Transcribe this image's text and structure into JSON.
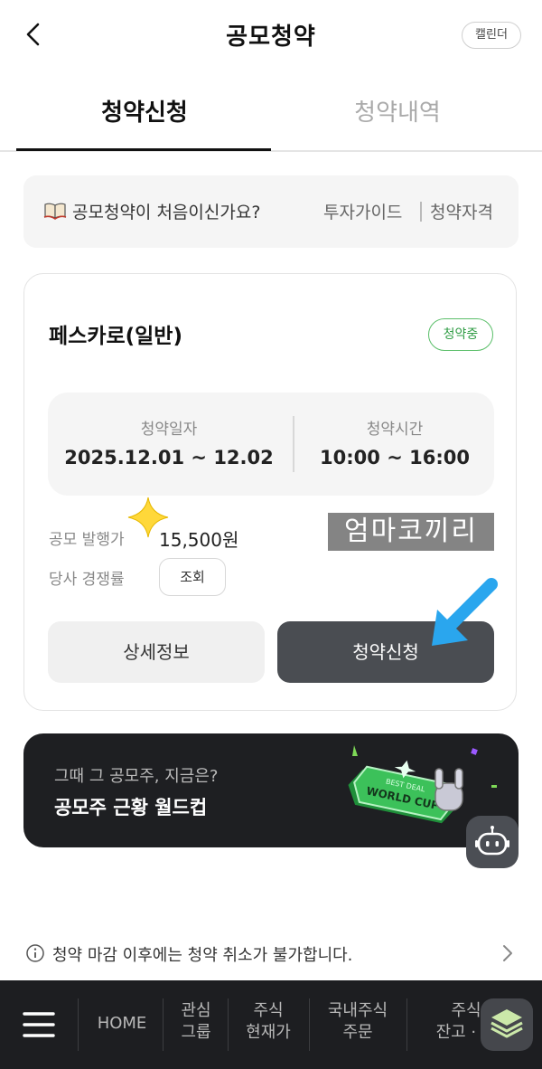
{
  "header": {
    "title": "공모청약",
    "calendar_label": "캘린더"
  },
  "tabs": [
    {
      "label": "청약신청",
      "active": true
    },
    {
      "label": "청약내역",
      "active": false
    }
  ],
  "guide": {
    "question": "공모청약이 처음이신가요?",
    "links": [
      "투자가이드",
      "청약자격"
    ]
  },
  "offering": {
    "name": "페스카로(일반)",
    "status": "청약중",
    "schedule": {
      "date_label": "청약일자",
      "date_value": "2025.12.01 ~ 12.02",
      "time_label": "청약시간",
      "time_value": "10:00 ~ 16:00"
    },
    "price_label": "공모 발행가",
    "price_value": "15,500원",
    "competition_label": "당사 경쟁률",
    "competition_button": "조회",
    "detail_button": "상세정보",
    "apply_button": "청약신청"
  },
  "watermark": "엄마코끼리",
  "banner": {
    "subtitle": "그때 그 공모주, 지금은?",
    "title": "공모주 근황 월드컵",
    "badge_line1": "BEST DEAL",
    "badge_line2": "WORLD CUP"
  },
  "notice": {
    "text": "청약 마감 이후에는 청약 취소가 불가합니다."
  },
  "bottom_nav": {
    "items": [
      {
        "line1": "HOME",
        "line2": ""
      },
      {
        "line1": "관심",
        "line2": "그룹"
      },
      {
        "line1": "주식",
        "line2": "현재가"
      },
      {
        "line1": "국내주식",
        "line2": "주문"
      },
      {
        "line1": "주식",
        "line2": "잔고 · 손"
      }
    ]
  },
  "colors": {
    "accent_green": "#2f9c44",
    "apply_button_bg": "#4a4d52",
    "banner_bg": "#1e1f22",
    "nav_bg": "#1d1e21",
    "arrow": "#2aa6ee"
  }
}
